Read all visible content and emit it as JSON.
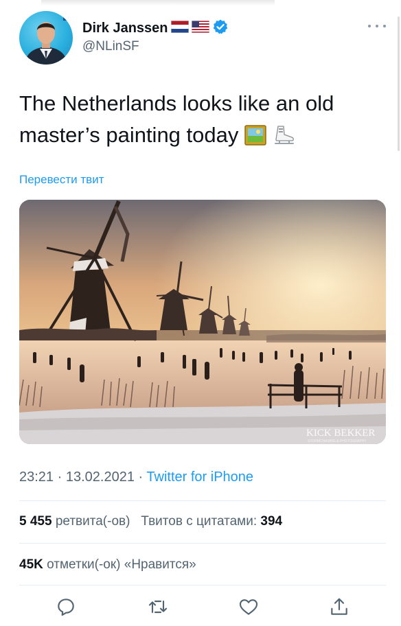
{
  "author": {
    "name": "Dirk Janssen",
    "handle": "@NLinSF",
    "verified": true,
    "flags": [
      "netherlands-flag",
      "usa-flag"
    ]
  },
  "tweet": {
    "line1": "The Netherlands looks like an old",
    "line2": "master’s painting today",
    "emojis": [
      "framed-picture-emoji",
      "ice-skate-emoji"
    ],
    "translate_label": "Перевести твит"
  },
  "photo": {
    "watermark": "KICK BEKKER",
    "watermark_sub": "STORMCHASING & PHOTOGRAPHY"
  },
  "meta": {
    "time": "23:21",
    "separator": "·",
    "date": "13.02.2021",
    "source": "Twitter for iPhone"
  },
  "stats": {
    "retweets_count": "5 455",
    "retweets_label": "ретвита(-ов)",
    "quotes_label": "Твитов с цитатами:",
    "quotes_count": "394",
    "likes_count": "45K",
    "likes_label": "отметки(-ок) «Нравится»"
  },
  "actions": [
    "reply-icon",
    "retweet-icon",
    "like-icon",
    "share-icon"
  ],
  "colors": {
    "accent": "#1d9bf0",
    "secondary_text": "#536471",
    "primary_text": "#0f1419",
    "divider": "#e6ecf0"
  }
}
